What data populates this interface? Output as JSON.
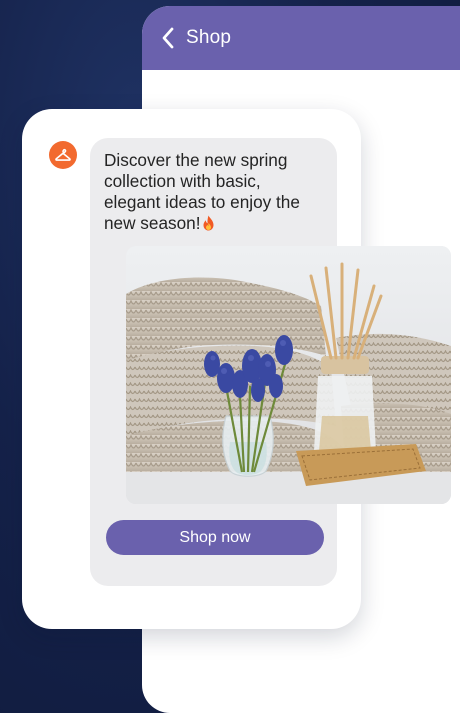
{
  "header": {
    "title": "Shop",
    "back_icon": "chevron-left-icon",
    "color": "#6a61ad"
  },
  "message": {
    "avatar_icon": "hanger-icon",
    "avatar_color": "#f26a2f",
    "text_lines": [
      "Discover the new spring",
      "collection with basic,",
      "elegant ideas to enjoy the",
      "new season!"
    ],
    "emoji": "fire-icon",
    "button_label": "Shop now",
    "button_color": "#6a61ad"
  }
}
